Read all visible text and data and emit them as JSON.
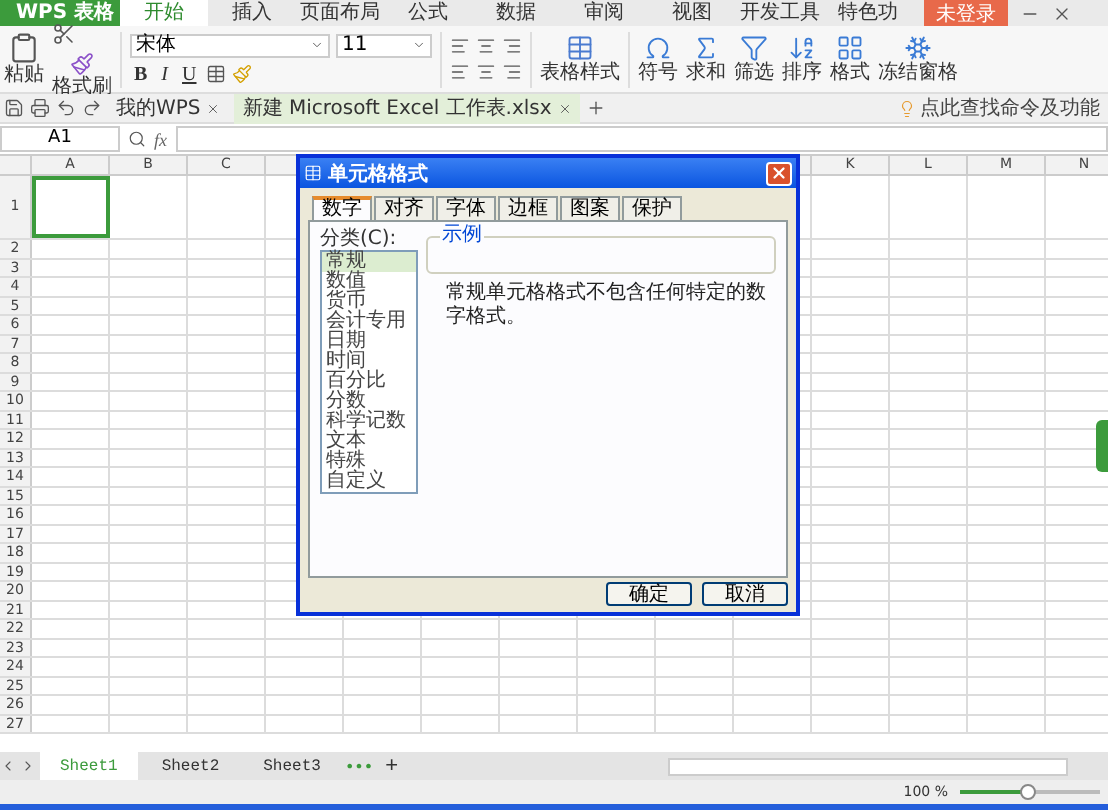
{
  "app_button": "WPS 表格",
  "menu_tabs": [
    {
      "label": "开始",
      "selected": true
    },
    {
      "label": "插入",
      "selected": false
    },
    {
      "label": "页面布局",
      "selected": false
    },
    {
      "label": "公式",
      "selected": false
    },
    {
      "label": "数据",
      "selected": false
    },
    {
      "label": "审阅",
      "selected": false
    },
    {
      "label": "视图",
      "selected": false
    },
    {
      "label": "开发工具",
      "selected": false
    },
    {
      "label": "特色功",
      "selected": false
    }
  ],
  "login_button": "未登录",
  "ribbon": {
    "paste": "粘贴",
    "format_painter": "格式刷",
    "font_name": "宋体",
    "font_size": "11",
    "bold": "B",
    "italic": "I",
    "underline": "U",
    "table_style": "表格样式",
    "tools": [
      {
        "label": "符号"
      },
      {
        "label": "求和"
      },
      {
        "label": "筛选"
      },
      {
        "label": "排序"
      },
      {
        "label": "格式"
      },
      {
        "label": "冻结窗格"
      }
    ]
  },
  "doc_tabs": [
    {
      "label": "我的WPS",
      "selected": false
    },
    {
      "label": "新建 Microsoft Excel 工作表.xlsx",
      "selected": true
    }
  ],
  "command_search": "点此查找命令及功能",
  "formula_bar": {
    "cell_ref": "A1",
    "fx": "fx"
  },
  "sheet": {
    "columns_left": [
      "A",
      "B",
      "C"
    ],
    "columns_right": [
      "K",
      "L",
      "M",
      "N"
    ],
    "rows": [
      "1",
      "2",
      "3",
      "4",
      "5",
      "6",
      "7",
      "8",
      "9",
      "10",
      "11",
      "12",
      "13",
      "14",
      "15",
      "16",
      "17",
      "18",
      "19",
      "20",
      "21",
      "22",
      "23",
      "24",
      "25",
      "26",
      "27"
    ]
  },
  "dialog": {
    "title": "单元格格式",
    "tabs": [
      {
        "label": "数字",
        "selected": true
      },
      {
        "label": "对齐",
        "selected": false
      },
      {
        "label": "字体",
        "selected": false
      },
      {
        "label": "边框",
        "selected": false
      },
      {
        "label": "图案",
        "selected": false
      },
      {
        "label": "保护",
        "selected": false
      }
    ],
    "category_label": "分类(C):",
    "categories": [
      {
        "label": "常规",
        "selected": true
      },
      {
        "label": "数值",
        "selected": false
      },
      {
        "label": "货币",
        "selected": false
      },
      {
        "label": "会计专用",
        "selected": false
      },
      {
        "label": "日期",
        "selected": false
      },
      {
        "label": "时间",
        "selected": false
      },
      {
        "label": "百分比",
        "selected": false
      },
      {
        "label": "分数",
        "selected": false
      },
      {
        "label": "科学记数",
        "selected": false
      },
      {
        "label": "文本",
        "selected": false
      },
      {
        "label": "特殊",
        "selected": false
      },
      {
        "label": "自定义",
        "selected": false
      }
    ],
    "sample_label": "示例",
    "description": "常规单元格格式不包含任何特定的数字格式。",
    "buttons": [
      "确定",
      "取消"
    ]
  },
  "sheet_tabs": [
    {
      "label": "Sheet1",
      "selected": true
    },
    {
      "label": "Sheet2",
      "selected": false
    },
    {
      "label": "Sheet3",
      "selected": false
    }
  ],
  "more_sheets": "•••",
  "add_sheet": "+",
  "status_bar": {
    "zoom": "100 %",
    "zoom_slider": {
      "level": 0.48
    }
  }
}
